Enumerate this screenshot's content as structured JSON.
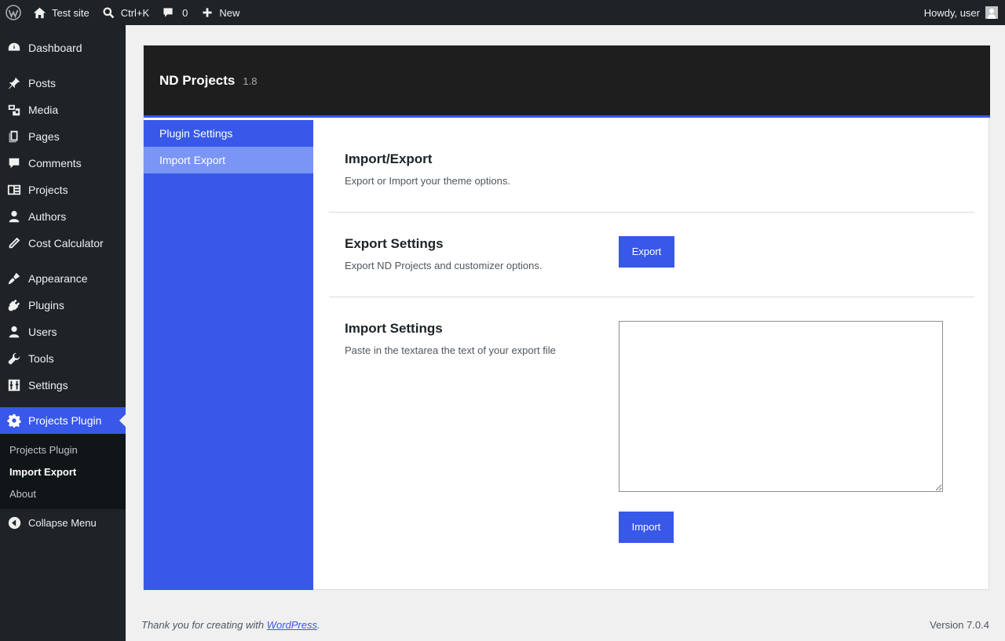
{
  "adminbar": {
    "site_name": "Test site",
    "search_shortcut": "Ctrl+K",
    "comments_count": "0",
    "new_label": "New",
    "greeting": "Howdy, user"
  },
  "sidebar": {
    "items": [
      {
        "label": "Dashboard",
        "icon": "dashboard-icon"
      },
      {
        "label": "Posts",
        "icon": "pin-icon"
      },
      {
        "label": "Media",
        "icon": "media-icon"
      },
      {
        "label": "Pages",
        "icon": "pages-icon"
      },
      {
        "label": "Comments",
        "icon": "comment-icon"
      },
      {
        "label": "Projects",
        "icon": "projects-icon"
      },
      {
        "label": "Authors",
        "icon": "user-icon"
      },
      {
        "label": "Cost Calculator",
        "icon": "pencil-icon"
      },
      {
        "label": "Appearance",
        "icon": "brush-icon"
      },
      {
        "label": "Plugins",
        "icon": "plug-icon"
      },
      {
        "label": "Users",
        "icon": "users-icon"
      },
      {
        "label": "Tools",
        "icon": "wrench-icon"
      },
      {
        "label": "Settings",
        "icon": "sliders-icon"
      },
      {
        "label": "Projects Plugin",
        "icon": "gear-icon"
      }
    ],
    "submenu": [
      "Projects Plugin",
      "Import Export",
      "About"
    ],
    "collapse_label": "Collapse Menu"
  },
  "panel": {
    "title": "ND Projects",
    "version": "1.8",
    "nav": [
      "Plugin Settings",
      "Import Export"
    ],
    "sections": {
      "intro": {
        "title": "Import/Export",
        "desc": "Export or Import your theme options."
      },
      "export": {
        "title": "Export Settings",
        "desc": "Export ND Projects and customizer options.",
        "button": "Export"
      },
      "import": {
        "title": "Import Settings",
        "desc": "Paste in the textarea the text of your export file",
        "button": "Import",
        "textarea_value": ""
      }
    }
  },
  "footer": {
    "thanks_prefix": "Thank you for creating with ",
    "thanks_link": "WordPress",
    "thanks_suffix": ".",
    "version": "Version 7.0.4"
  },
  "colors": {
    "accent": "#3858e9",
    "accent_light": "#7b95f5",
    "admin_dark": "#1d2327",
    "header_dark": "#1e1e1e"
  }
}
